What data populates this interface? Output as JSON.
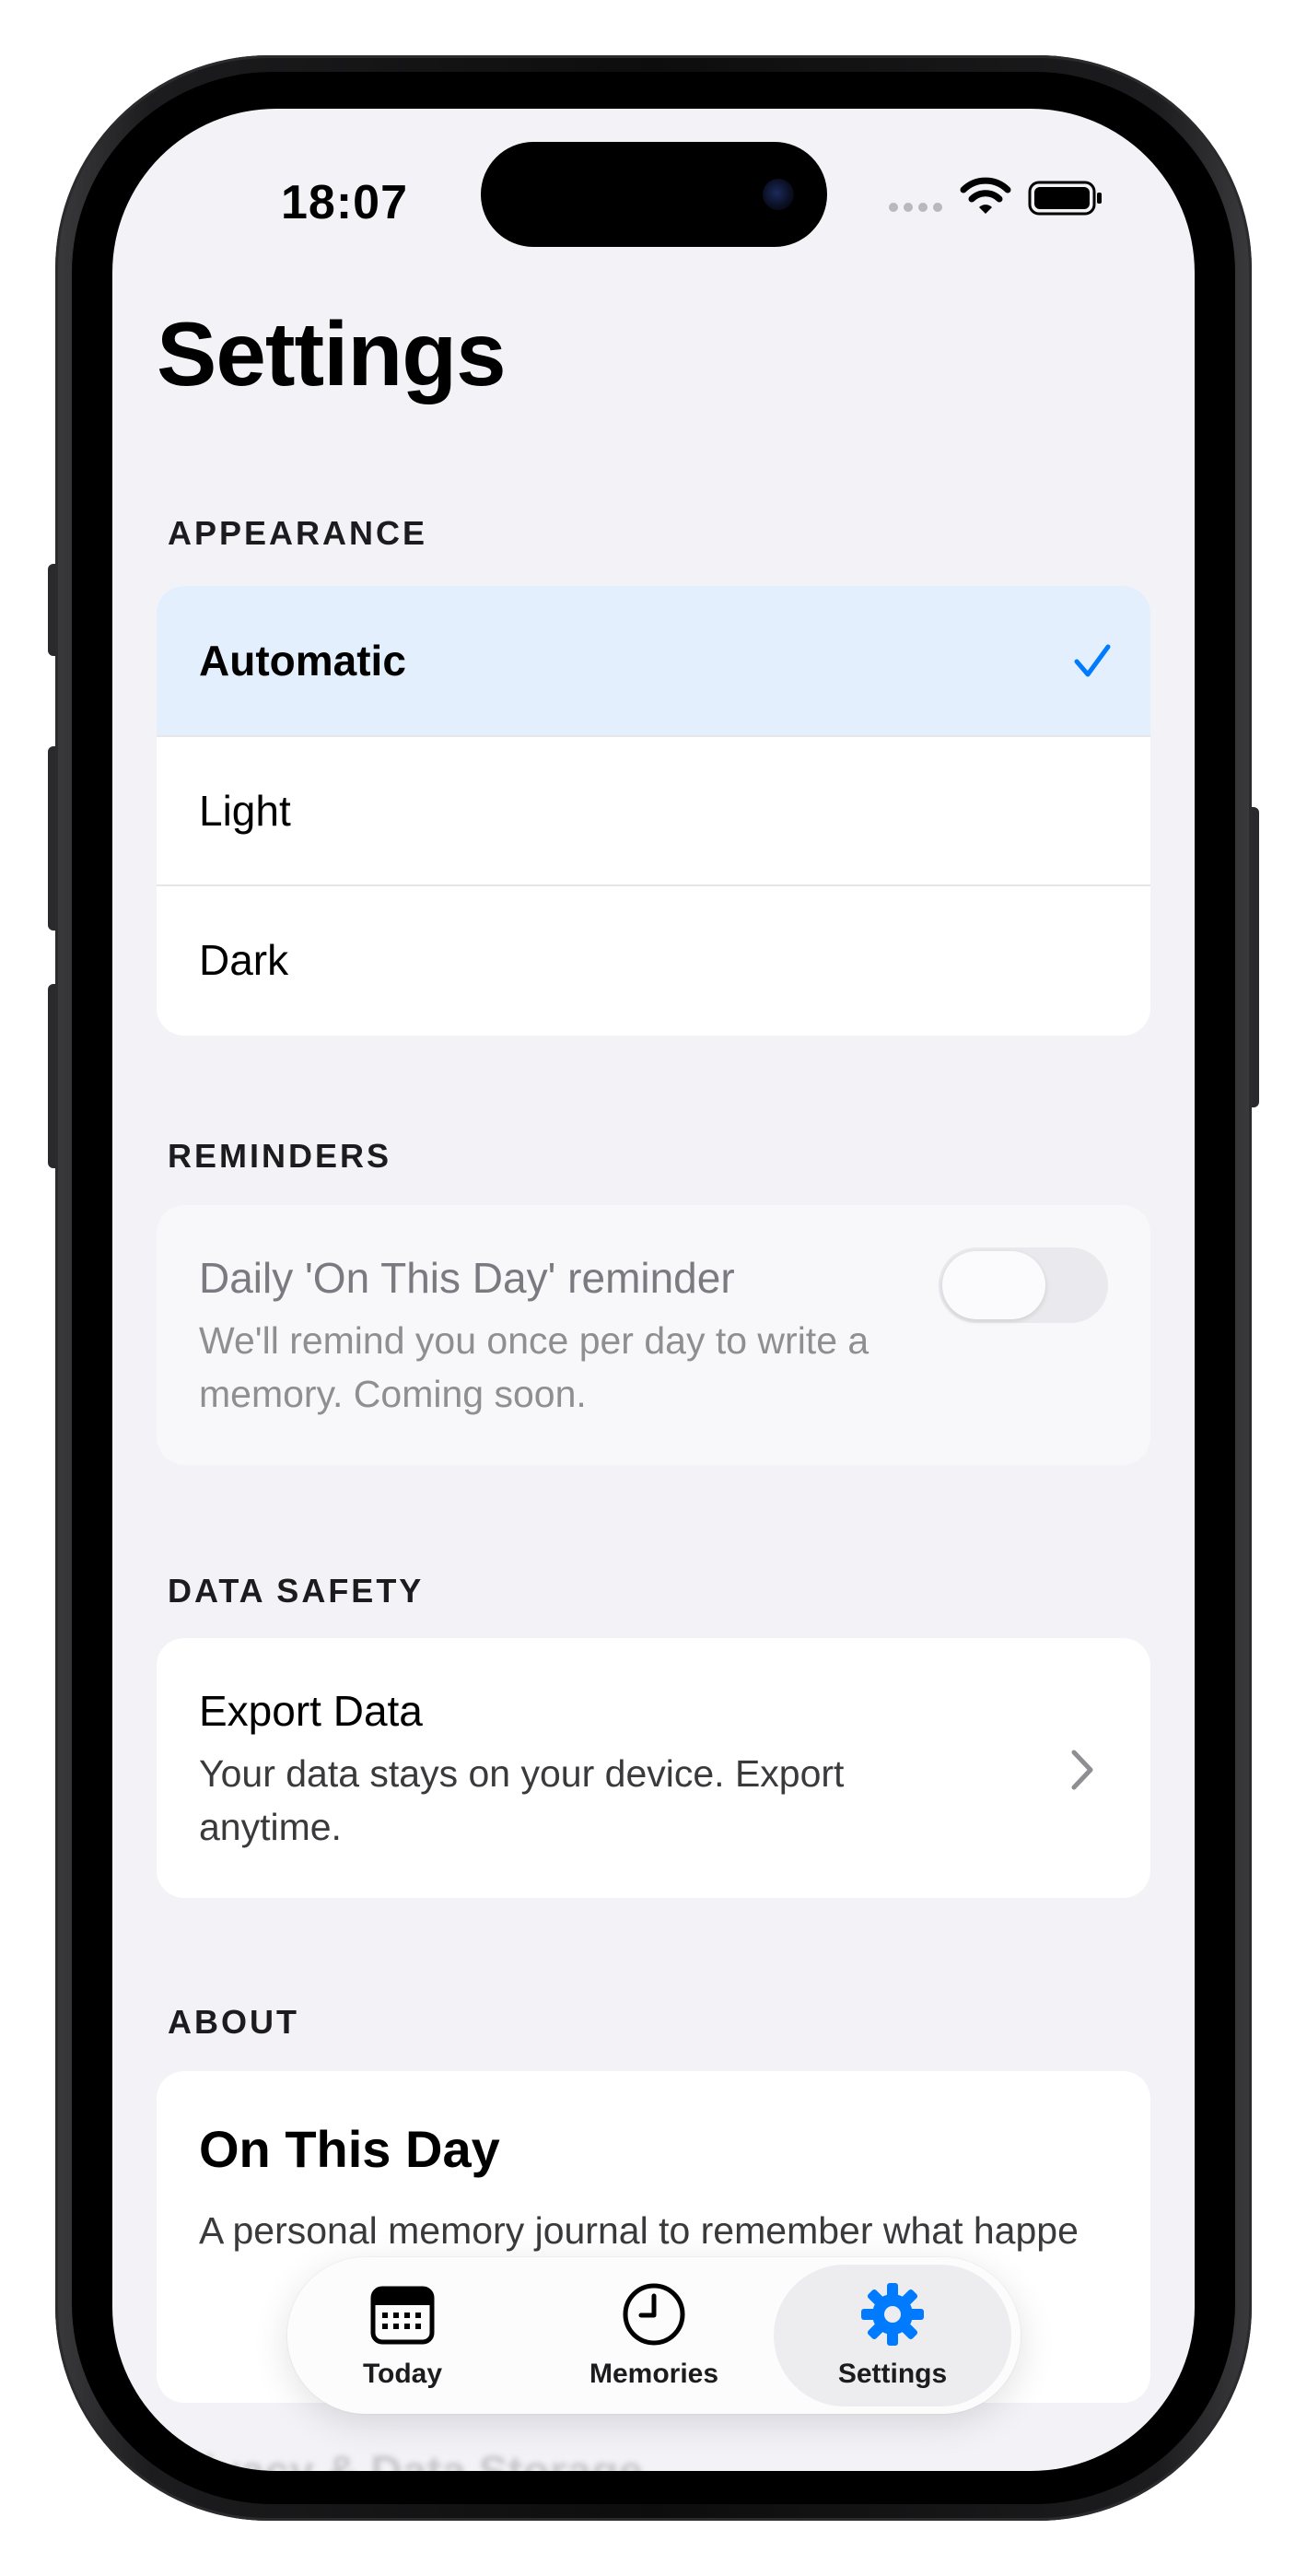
{
  "status_bar": {
    "time": "18:07"
  },
  "page": {
    "title": "Settings"
  },
  "appearance": {
    "header": "APPEARANCE",
    "options": [
      {
        "label": "Automatic",
        "selected": true
      },
      {
        "label": "Light",
        "selected": false
      },
      {
        "label": "Dark",
        "selected": false
      }
    ]
  },
  "reminders": {
    "header": "REMINDERS",
    "title": "Daily 'On This Day' reminder",
    "description": "We'll remind you once per day to write a memory. Coming soon.",
    "toggle_on": false
  },
  "data_safety": {
    "header": "DATA SAFETY",
    "title": "Export Data",
    "description": "Your data stays on your device. Export anytime."
  },
  "about": {
    "header": "ABOUT",
    "app_name": "On This Day",
    "description": "A personal memory journal to remember what happe",
    "next_item": "Privacy & Data Storage"
  },
  "tab_bar": {
    "tabs": [
      {
        "label": "Today",
        "icon": "calendar-icon",
        "active": false
      },
      {
        "label": "Memories",
        "icon": "clock-icon",
        "active": false
      },
      {
        "label": "Settings",
        "icon": "gear-icon",
        "active": true
      }
    ]
  },
  "colors": {
    "accent": "#007aff",
    "selected_row": "#e3effd",
    "background": "#f2f2f7"
  }
}
